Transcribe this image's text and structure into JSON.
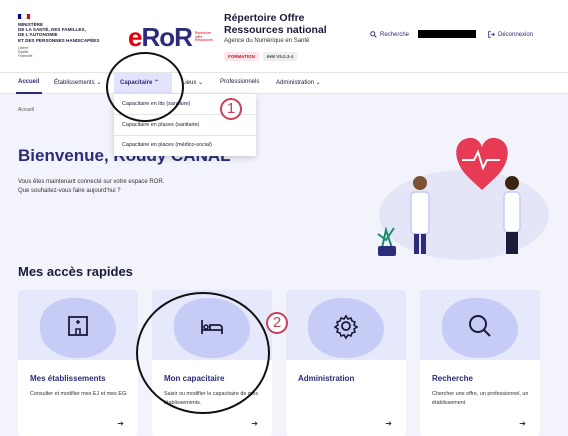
{
  "header": {
    "flag_colors": [
      "#000091",
      "#ffffff",
      "#e1000f"
    ],
    "ministry": [
      "MINISTÈRE",
      "DE LA SANTÉ, DES FAMILLES,",
      "DE L'AUTONOMIE",
      "ET DES PERSONNES HANDICAPÉES"
    ],
    "motto": [
      "Liberté",
      "Égalité",
      "Fraternité"
    ],
    "logo_e": "e",
    "logo_ror": "RoR",
    "logo_sub": [
      "Répertoire",
      "Offre",
      "Ressources"
    ],
    "app_title": "Répertoire Offre Ressources national",
    "agency": "Agence du Numérique en Santé",
    "badge_env": "FORMATION",
    "badge_version": "IHM V5.0.3-4",
    "search_label": "Recherche",
    "logout_label": "Déconnexion"
  },
  "nav": {
    "items": [
      "Accueil",
      "Établissements",
      "Capacitaire",
      "Lieux",
      "Professionnels",
      "Administration"
    ],
    "active": "Accueil",
    "open": "Capacitaire"
  },
  "dropdown": {
    "items": [
      "Capacitaire en lits (sanitaire)",
      "Capacitaire en places (sanitaire)",
      "Capacitaire en places (médico-social)"
    ]
  },
  "breadcrumb": "Accueil",
  "welcome": {
    "title": "Bienvenue, Roddy CANAL",
    "line1": "Vous êtes maintenant connecté sur votre espace ROR.",
    "line2": "Que souhaitez-vous faire aujourd'hui ?"
  },
  "quick_access": {
    "title": "Mes accès rapides",
    "cards": [
      {
        "title": "Mes établissements",
        "desc": "Consulter et modifier mes EJ et mes EG.",
        "icon": "building-icon"
      },
      {
        "title": "Mon capacitaire",
        "desc": "Saisir ou modifier le capacitaire de mes établissements.",
        "icon": "bed-icon"
      },
      {
        "title": "Administration",
        "desc": "",
        "icon": "gear-icon"
      },
      {
        "title": "Recherche",
        "desc": "Chercher une offre, un professionnel, un établissement",
        "icon": "search-icon"
      }
    ]
  },
  "annotations": {
    "step1": "1",
    "step2": "2"
  },
  "colors": {
    "primary": "#2c2c7a",
    "accent_red": "#e1000f",
    "annotation": "#c9415a",
    "card_bg": "#e6e8fb",
    "blob": "#c7ccf6"
  }
}
